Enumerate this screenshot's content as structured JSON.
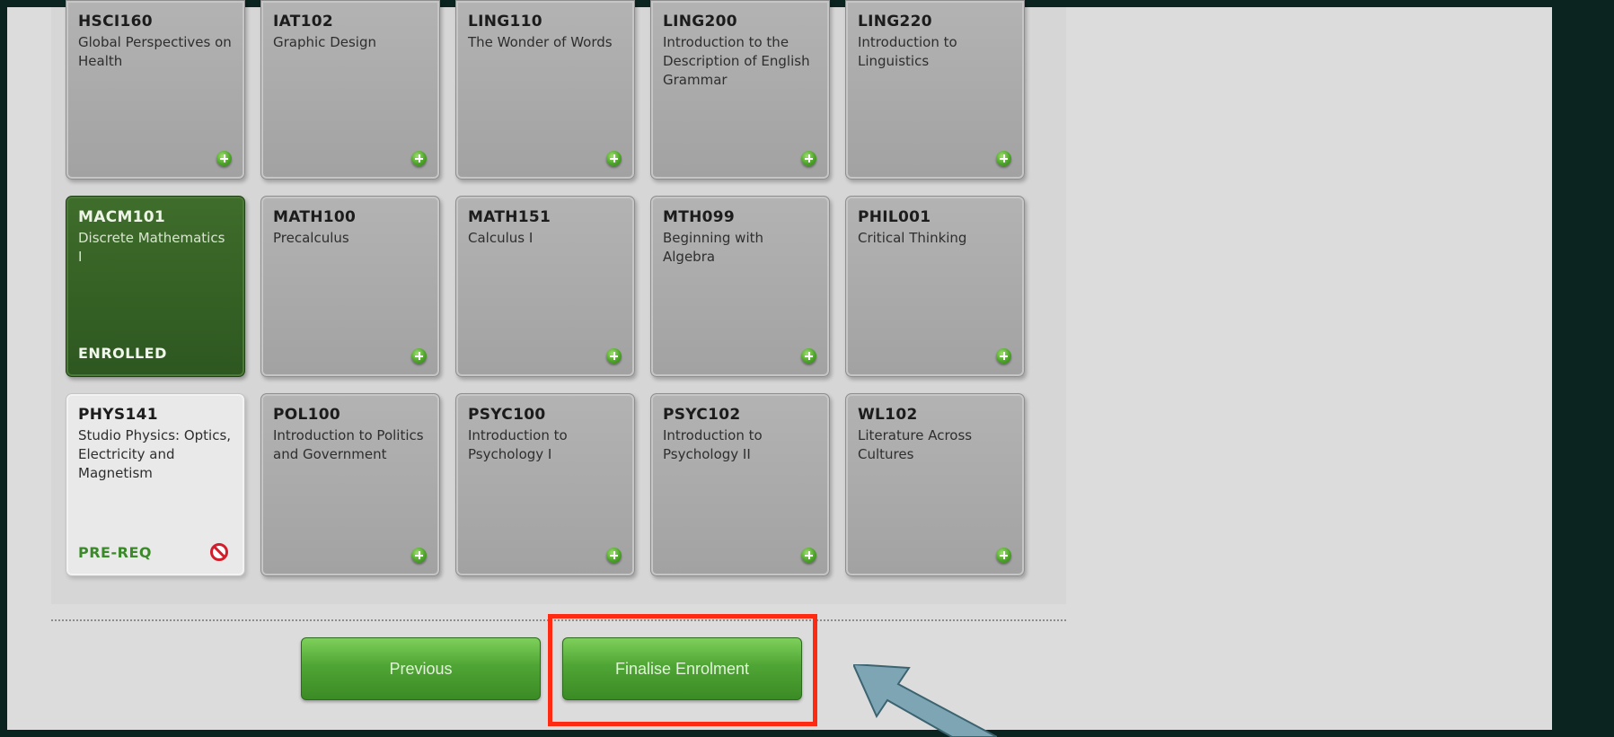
{
  "courses": [
    {
      "code": "HSCI160",
      "title": "Global Perspectives on Health",
      "status": ""
    },
    {
      "code": "IAT102",
      "title": "Graphic Design",
      "status": ""
    },
    {
      "code": "LING110",
      "title": "The Wonder of Words",
      "status": ""
    },
    {
      "code": "LING200",
      "title": "Introduction to the Description of English Grammar",
      "status": ""
    },
    {
      "code": "LING220",
      "title": "Introduction to Linguistics",
      "status": ""
    },
    {
      "code": "MACM101",
      "title": "Discrete Mathematics I",
      "status": "ENROLLED"
    },
    {
      "code": "MATH100",
      "title": "Precalculus",
      "status": ""
    },
    {
      "code": "MATH151",
      "title": "Calculus I",
      "status": ""
    },
    {
      "code": "MTH099",
      "title": "Beginning with Algebra",
      "status": ""
    },
    {
      "code": "PHIL001",
      "title": "Critical Thinking",
      "status": ""
    },
    {
      "code": "PHYS141",
      "title": "Studio Physics: Optics, Electricity and Magnetism",
      "status": "PRE-REQ"
    },
    {
      "code": "POL100",
      "title": "Introduction to Politics and Government",
      "status": ""
    },
    {
      "code": "PSYC100",
      "title": "Introduction to Psychology I",
      "status": ""
    },
    {
      "code": "PSYC102",
      "title": "Introduction to Psychology II",
      "status": ""
    },
    {
      "code": "WL102",
      "title": "Literature Across Cultures",
      "status": ""
    }
  ],
  "buttons": {
    "previous": "Previous",
    "finalise": "Finalise Enrolment"
  },
  "colors": {
    "enrolled_tile": "#3a6628",
    "prereq_status": "#3b8a2a",
    "button_green": "#4fa534",
    "highlight_red": "#ff2a12",
    "arrow_blue": "#7ea5b3"
  },
  "icons": {
    "add": "add-course-icon",
    "blocked": "blocked-icon"
  }
}
